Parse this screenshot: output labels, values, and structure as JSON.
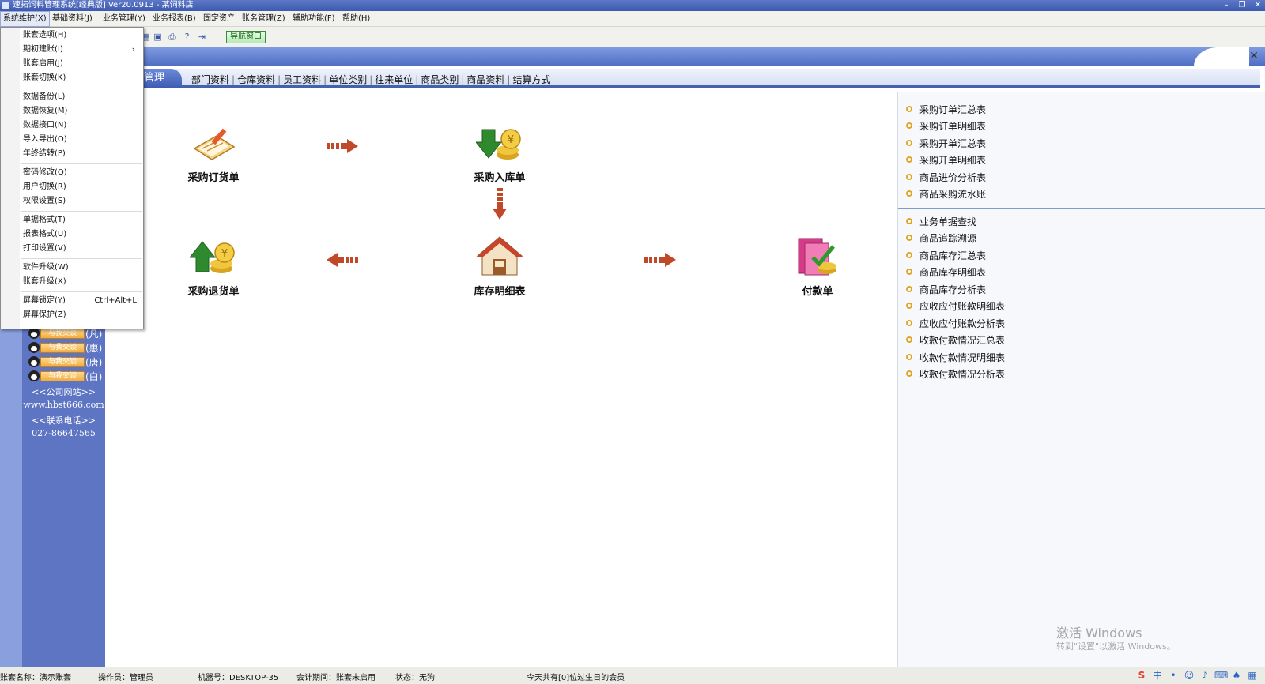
{
  "window": {
    "title": "速拓饲料管理系统[经典版] Ver20.0913 - 某饲料店"
  },
  "menubar": {
    "items": [
      "系统维护(X)",
      "基础资料(J)",
      "业务管理(Y)",
      "业务报表(B)",
      "固定资产",
      "账务管理(Z)",
      "辅助功能(F)",
      "帮助(H)"
    ]
  },
  "toolbar": {
    "nav_button": "导航窗口",
    "icons": [
      "grid-icon",
      "save-icon",
      "print-icon",
      "help-icon",
      "exit-icon"
    ]
  },
  "dropdown": {
    "groups": [
      [
        {
          "label": "账套选项(H)"
        },
        {
          "label": "期初建账(I)",
          "submenu": true
        },
        {
          "label": "账套启用(J)"
        },
        {
          "label": "账套切换(K)"
        }
      ],
      [
        {
          "label": "数据备份(L)"
        },
        {
          "label": "数据恢复(M)"
        },
        {
          "label": "数据接口(N)"
        },
        {
          "label": "导入导出(O)"
        },
        {
          "label": "年终结转(P)"
        }
      ],
      [
        {
          "label": "密码修改(Q)"
        },
        {
          "label": "用户切换(R)"
        },
        {
          "label": "权限设置(S)"
        }
      ],
      [
        {
          "label": "单据格式(T)"
        },
        {
          "label": "报表格式(U)"
        },
        {
          "label": "打印设置(V)"
        }
      ],
      [
        {
          "label": "软件升级(W)"
        },
        {
          "label": "账套升级(X)"
        }
      ],
      [
        {
          "label": "屏幕锁定(Y)",
          "shortcut": "Ctrl+Alt+L"
        },
        {
          "label": "屏幕保护(Z)"
        }
      ]
    ]
  },
  "category_bar": {
    "active": "管理",
    "tabs": [
      "部门资料",
      "仓库资料",
      "员工资料",
      "单位类别",
      "往来单位",
      "商品类别",
      "商品资料",
      "结算方式"
    ]
  },
  "left_panel": {
    "qq_contacts": [
      {
        "button": "与我交谈",
        "name": "(凡)"
      },
      {
        "button": "与我交谈",
        "name": "(惠)"
      },
      {
        "button": "与我交谈",
        "name": "(唐)"
      },
      {
        "button": "与我交谈",
        "name": "(白)"
      }
    ],
    "website_label": "<<公司网站>>",
    "website": "www.hbst666.com",
    "phone_label": "<<联系电话>>",
    "phone": "027-86647565"
  },
  "flow": {
    "nodes": {
      "purchase_order": "采购订货单",
      "purchase_in": "采购入库单",
      "purchase_return": "采购退货单",
      "stock_detail": "库存明细表",
      "payment": "付款单"
    }
  },
  "right_panel": {
    "group1": [
      "采购订单汇总表",
      "采购订单明细表",
      "采购开单汇总表",
      "采购开单明细表",
      "商品进价分析表",
      "商品采购流水账"
    ],
    "group2": [
      "业务单据查找",
      "商品追踪溯源",
      "商品库存汇总表",
      "商品库存明细表",
      "商品库存分析表",
      "应收应付账款明细表",
      "应收应付账款分析表",
      "收款付款情况汇总表",
      "收款付款情况明细表",
      "收款付款情况分析表"
    ],
    "watermark_line1": "激活 Windows",
    "watermark_line2": "转到\"设置\"以激活 Windows。"
  },
  "statusbar": {
    "account": "账套名称：演示账套",
    "operator": "操作员：管理员",
    "machine": "机器号：DESKTOP-35",
    "period": "会计期间：账套未启用",
    "status": "状态：无狗",
    "birthday": "今天共有[0]位过生日的会员"
  },
  "colors": {
    "title_bar": "#3c5aaf",
    "left_panel": "#5e75c4",
    "accent_tab": "#4660b0",
    "arrow": "#c0492a",
    "bullet": "#e0a426"
  }
}
